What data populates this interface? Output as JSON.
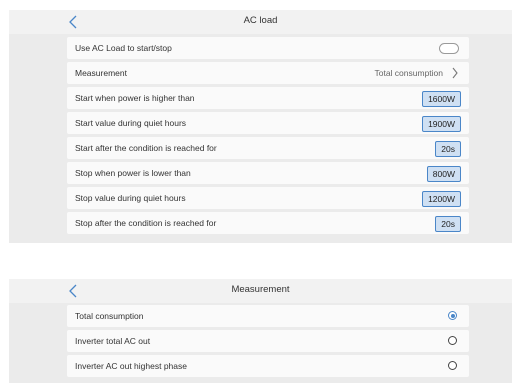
{
  "ac_load": {
    "title": "AC load",
    "rows": [
      {
        "label": "Use AC Load to start/stop"
      },
      {
        "label": "Measurement",
        "value": "Total consumption"
      },
      {
        "label": "Start when power is higher than",
        "value": "1600W"
      },
      {
        "label": "Start value during quiet hours",
        "value": "1900W"
      },
      {
        "label": "Start after the condition is reached for",
        "value": "20s"
      },
      {
        "label": "Stop when power is lower than",
        "value": "800W"
      },
      {
        "label": "Stop value during quiet hours",
        "value": "1200W"
      },
      {
        "label": "Stop after the condition is reached for",
        "value": "20s"
      }
    ],
    "toggle_on": false
  },
  "measurement": {
    "title": "Measurement",
    "options": [
      {
        "label": "Total consumption",
        "selected": true
      },
      {
        "label": "Inverter total AC out",
        "selected": false
      },
      {
        "label": "Inverter AC out highest phase",
        "selected": false
      }
    ]
  },
  "colors": {
    "accent": "#4a86c8",
    "value_fill": "#cfe0f3",
    "panel_bg": "#ebebeb",
    "row_bg": "#fafafa"
  },
  "icons": {
    "back": "chevron-left-icon",
    "forward": "chevron-right-icon",
    "toggle": "switch-off",
    "radio_on": "radio-selected",
    "radio_off": "radio-unselected"
  }
}
